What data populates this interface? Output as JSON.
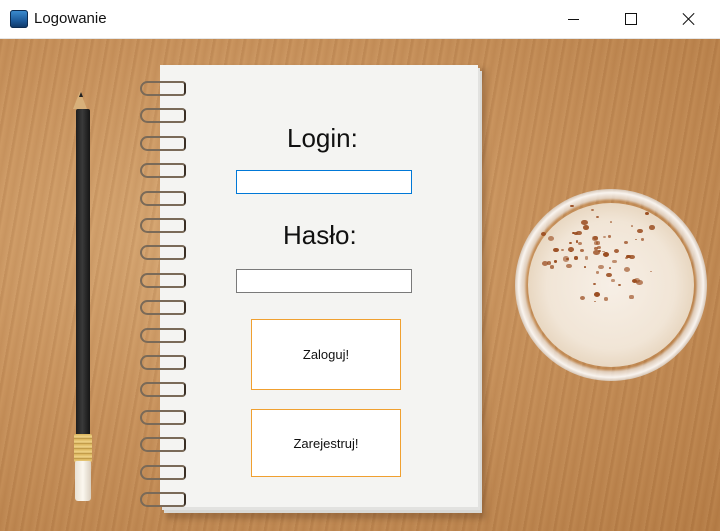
{
  "window": {
    "title": "Logowanie",
    "icon": "app-icon",
    "controls": [
      "minimize-icon",
      "maximize-icon",
      "close-icon"
    ]
  },
  "form": {
    "login_label": "Login:",
    "login_value": "",
    "password_label": "Hasło:",
    "password_value": "",
    "login_button": "Zaloguj!",
    "register_button": "Zarejestruj!"
  },
  "colors": {
    "button_border": "#f0a030",
    "focused_border": "#0078d7"
  }
}
